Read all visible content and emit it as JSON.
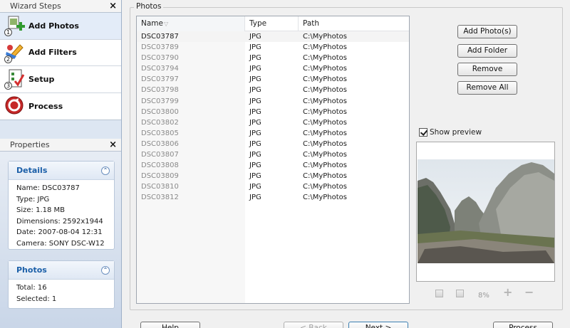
{
  "wizard": {
    "title": "Wizard Steps",
    "steps": [
      {
        "label": "Add Photos",
        "num": "1",
        "icon": "add-photos-icon",
        "active": true
      },
      {
        "label": "Add Filters",
        "num": "2",
        "icon": "brush-filters-icon",
        "active": false
      },
      {
        "label": "Setup",
        "num": "3",
        "icon": "checklist-setup-icon",
        "active": false
      },
      {
        "label": "Process",
        "num": "",
        "icon": "process-icon",
        "active": false
      }
    ]
  },
  "properties": {
    "title": "Properties",
    "details": {
      "title": "Details",
      "lines": [
        "Name: DSC03787",
        "Type: JPG",
        "Size: 1.18 MB",
        "Dimensions: 2592x1944",
        "Date: 2007-08-04 12:31",
        "Camera: SONY DSC-W12"
      ]
    },
    "photos": {
      "title": "Photos",
      "lines": [
        "Total: 16",
        "Selected: 1"
      ]
    }
  },
  "photos_group": {
    "title": "Photos",
    "columns": [
      "Name",
      "Type",
      "Path"
    ],
    "rows": [
      [
        "DSC03787",
        "JPG",
        "C:\\MyPhotos"
      ],
      [
        "DSC03789",
        "JPG",
        "C:\\MyPhotos"
      ],
      [
        "DSC03790",
        "JPG",
        "C:\\MyPhotos"
      ],
      [
        "DSC03794",
        "JPG",
        "C:\\MyPhotos"
      ],
      [
        "DSC03797",
        "JPG",
        "C:\\MyPhotos"
      ],
      [
        "DSC03798",
        "JPG",
        "C:\\MyPhotos"
      ],
      [
        "DSC03799",
        "JPG",
        "C:\\MyPhotos"
      ],
      [
        "DSC03800",
        "JPG",
        "C:\\MyPhotos"
      ],
      [
        "DSC03802",
        "JPG",
        "C:\\MyPhotos"
      ],
      [
        "DSC03805",
        "JPG",
        "C:\\MyPhotos"
      ],
      [
        "DSC03806",
        "JPG",
        "C:\\MyPhotos"
      ],
      [
        "DSC03807",
        "JPG",
        "C:\\MyPhotos"
      ],
      [
        "DSC03808",
        "JPG",
        "C:\\MyPhotos"
      ],
      [
        "DSC03809",
        "JPG",
        "C:\\MyPhotos"
      ],
      [
        "DSC03810",
        "JPG",
        "C:\\MyPhotos"
      ],
      [
        "DSC03812",
        "JPG",
        "C:\\MyPhotos"
      ]
    ],
    "selected_row": 0,
    "buttons": {
      "add_photos": "Add Photo(s)",
      "add_folder": "Add Folder",
      "remove": "Remove",
      "remove_all": "Remove All"
    },
    "show_preview_label": "Show preview",
    "show_preview_checked": true,
    "zoom": "8%"
  },
  "footer": {
    "help": "Help",
    "back": "< Back",
    "next": "Next >",
    "process": "Process"
  }
}
